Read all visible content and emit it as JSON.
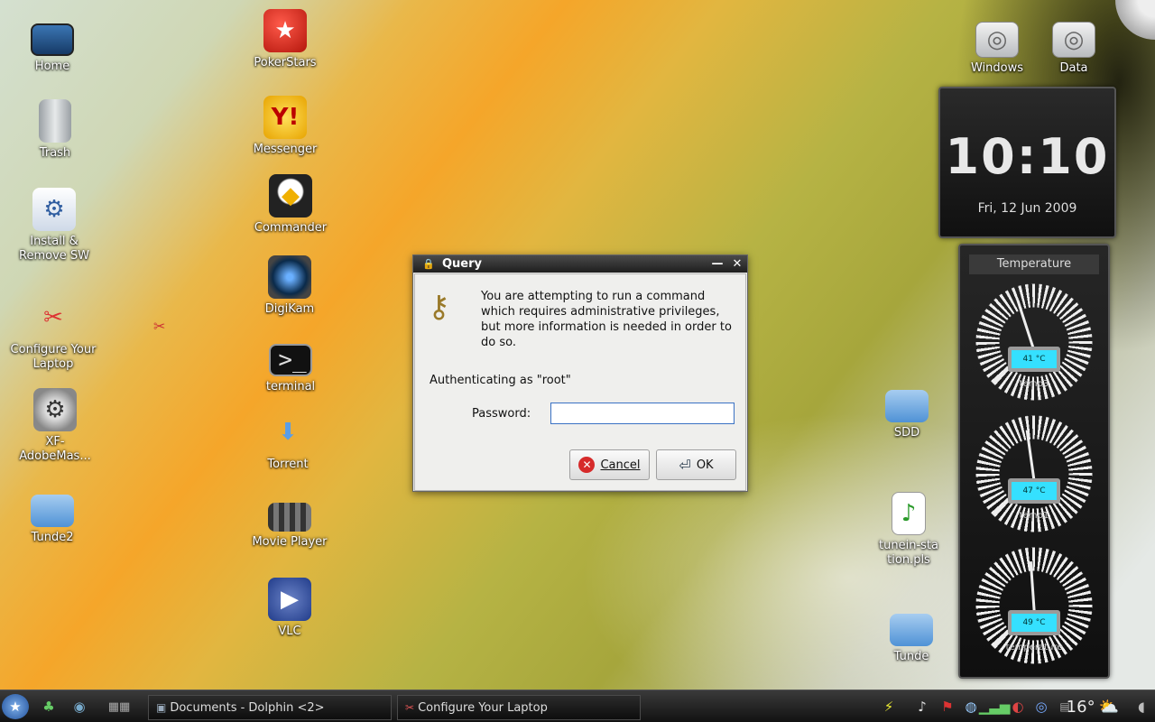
{
  "desktop": {
    "icons": {
      "home": "Home",
      "trash": "Trash",
      "install": "Install & Remove SW",
      "configure": "Configure Your Laptop",
      "xf": "XF-AdobeMas...",
      "tunde2": "Tunde2",
      "pokerstars": "PokerStars",
      "messenger": "Messenger",
      "commander": "Commander",
      "digikam": "DigiKam",
      "terminal": "terminal",
      "torrent": "Torrent",
      "movie_player": "Movie Player",
      "vlc": "VLC",
      "windows": "Windows",
      "data": "Data",
      "sdd": "SDD",
      "tunein": "tunein-station.pls",
      "tunde": "Tunde"
    }
  },
  "clock": {
    "time": "10:10",
    "date": "Fri, 12 Jun 2009"
  },
  "temperature": {
    "title": "Temperature",
    "sensors": [
      {
        "value": "41 °C",
        "label": "temp3"
      },
      {
        "value": "47 °C",
        "label": "temp1"
      },
      {
        "value": "49 °C",
        "label": "temperature"
      }
    ]
  },
  "dialog": {
    "title": "Query",
    "message": "You are attempting to run a command which requires administrative privileges, but more information is needed in order to do so.",
    "auth_text": "Authenticating as \"root\"",
    "password_label": "Password:",
    "password_value": "",
    "cancel_label": "Cancel",
    "ok_label": "OK",
    "minimize": "—",
    "close": "✕"
  },
  "taskbar": {
    "tasks": [
      "Documents - Dolphin <2>",
      "Configure Your Laptop"
    ],
    "weather_temp": "16°"
  }
}
